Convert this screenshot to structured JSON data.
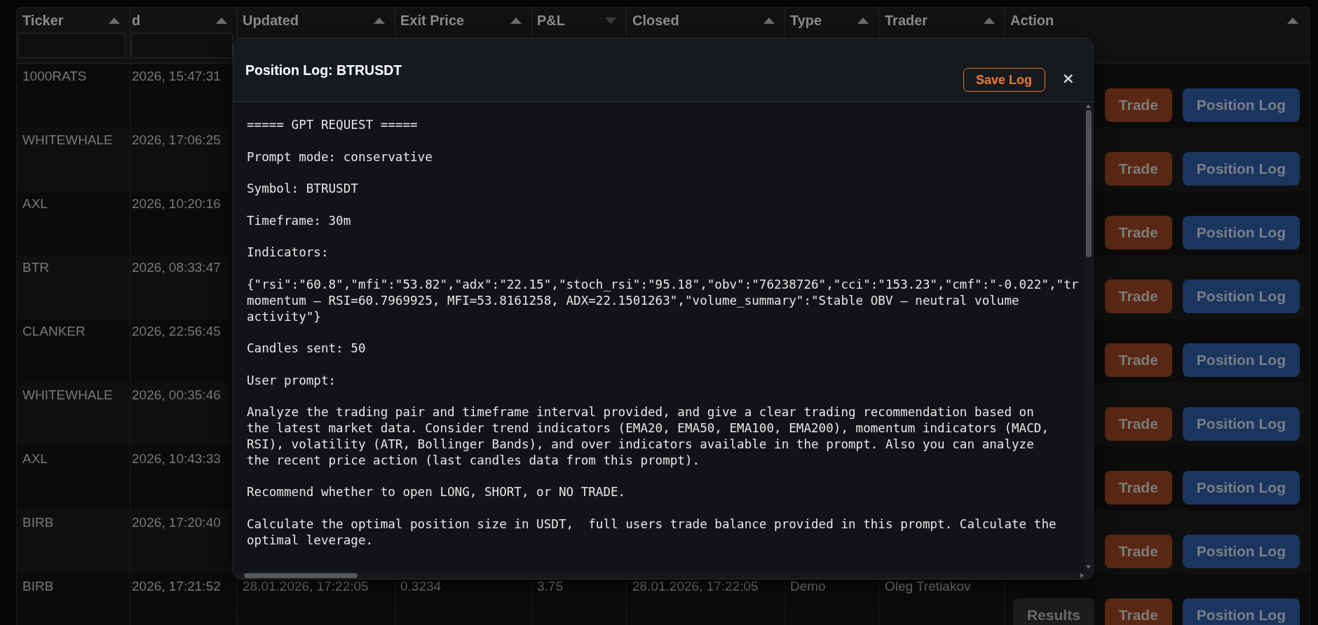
{
  "table": {
    "columns": [
      {
        "label": "Ticker",
        "descending": false,
        "filter": true
      },
      {
        "label": "d",
        "descending": false,
        "filter": true
      },
      {
        "label": "Updated",
        "descending": false,
        "filter": false
      },
      {
        "label": "Exit Price",
        "descending": false,
        "filter": false
      },
      {
        "label": "P&L",
        "descending": true,
        "filter": false
      },
      {
        "label": "Closed",
        "descending": false,
        "filter": false
      },
      {
        "label": "Type",
        "descending": false,
        "filter": false
      },
      {
        "label": "Trader",
        "descending": false,
        "filter": false
      },
      {
        "label": "Action",
        "descending": false,
        "filter": false
      }
    ],
    "rows": [
      {
        "cells": [
          "1000RATS",
          "2026, 15:47:31"
        ],
        "actions": [
          {
            "kind": "trade",
            "label": "Trade"
          },
          {
            "kind": "log",
            "label": "Position Log"
          }
        ]
      },
      {
        "cells": [
          "WHITEWHALE",
          "2026, 17:06:25"
        ],
        "actions": [
          {
            "kind": "trade",
            "label": "Trade"
          },
          {
            "kind": "log",
            "label": "Position Log"
          }
        ]
      },
      {
        "cells": [
          "AXL",
          "2026, 10:20:16"
        ],
        "actions": [
          {
            "kind": "trade",
            "label": "Trade"
          },
          {
            "kind": "log",
            "label": "Position Log"
          }
        ]
      },
      {
        "cells": [
          "BTR",
          "2026, 08:33:47"
        ],
        "actions": [
          {
            "kind": "trade",
            "label": "Trade"
          },
          {
            "kind": "log",
            "label": "Position Log"
          }
        ]
      },
      {
        "cells": [
          "CLANKER",
          "2026, 22:56:45"
        ],
        "actions": [
          {
            "kind": "trade",
            "label": "Trade"
          },
          {
            "kind": "log",
            "label": "Position Log"
          }
        ]
      },
      {
        "cells": [
          "WHITEWHALE",
          "2026, 00:35:46"
        ],
        "actions": [
          {
            "kind": "trade",
            "label": "Trade"
          },
          {
            "kind": "log",
            "label": "Position Log"
          }
        ]
      },
      {
        "cells": [
          "AXL",
          "2026, 10:43:33"
        ],
        "actions": [
          {
            "kind": "trade",
            "label": "Trade"
          },
          {
            "kind": "log",
            "label": "Position Log"
          }
        ]
      },
      {
        "cells": [
          "BIRB",
          "2026, 17:20:40"
        ],
        "actions": [
          {
            "kind": "trade",
            "label": "Trade"
          },
          {
            "kind": "log",
            "label": "Position Log"
          }
        ]
      },
      {
        "cells": [
          "BIRB",
          "2026, 17:21:52",
          "28.01.2026, 17:22:05",
          "0.3234",
          "3.75",
          "28.01.2026, 17:22:05",
          "Demo",
          "Oleg Tretiakov"
        ],
        "actions": [
          {
            "kind": "results",
            "label": "Results"
          },
          {
            "kind": "trade",
            "label": "Trade"
          },
          {
            "kind": "log",
            "label": "Position Log"
          }
        ]
      }
    ]
  },
  "modal": {
    "title": "Position Log: BTRUSDT",
    "save_button": "Save Log",
    "close_button": "×",
    "log": [
      {
        "kind": "paragraph",
        "text": "===== GPT REQUEST ====="
      },
      {
        "kind": "paragraph",
        "text": "Prompt mode: conservative"
      },
      {
        "kind": "paragraph",
        "text": "Symbol: BTRUSDT"
      },
      {
        "kind": "paragraph",
        "text": "Timeframe: 30m"
      },
      {
        "kind": "paragraph",
        "text": "Indicators:"
      },
      {
        "kind": "overflow",
        "text": "{\"rsi\":\"60.8\",\"mfi\":\"53.82\",\"adx\":\"22.15\",\"stoch_rsi\":\"95.18\",\"obv\":\"76238726\",\"cci\":\"153.23\",\"cmf\":\"-0.022\",\"tr"
      },
      {
        "kind": "paragraph",
        "text": "momentum — RSI=60.7969925, MFI=53.8161258, ADX=22.1501263\",\"volume_summary\":\"Stable OBV — neutral volume activity\"}"
      },
      {
        "kind": "paragraph",
        "text": "Candles sent: 50"
      },
      {
        "kind": "paragraph",
        "text": "User prompt:"
      },
      {
        "kind": "paragraph",
        "text": "Analyze the trading pair and timeframe interval provided, and give a clear trading recommendation based on the latest market data. Consider trend indicators (EMA20, EMA50, EMA100, EMA200), momentum indicators (MACD, RSI), volatility (ATR, Bollinger Bands), and over indicators available in the prompt. Also you can analyze the recent price action (last candles data from this prompt)."
      },
      {
        "kind": "paragraph",
        "text": "Recommend whether to open LONG, SHORT, or NO TRADE."
      },
      {
        "kind": "paragraph",
        "text": "Calculate the optimal position size in USDT,  full users trade balance provided in this prompt. Calculate the optimal leverage."
      }
    ]
  }
}
